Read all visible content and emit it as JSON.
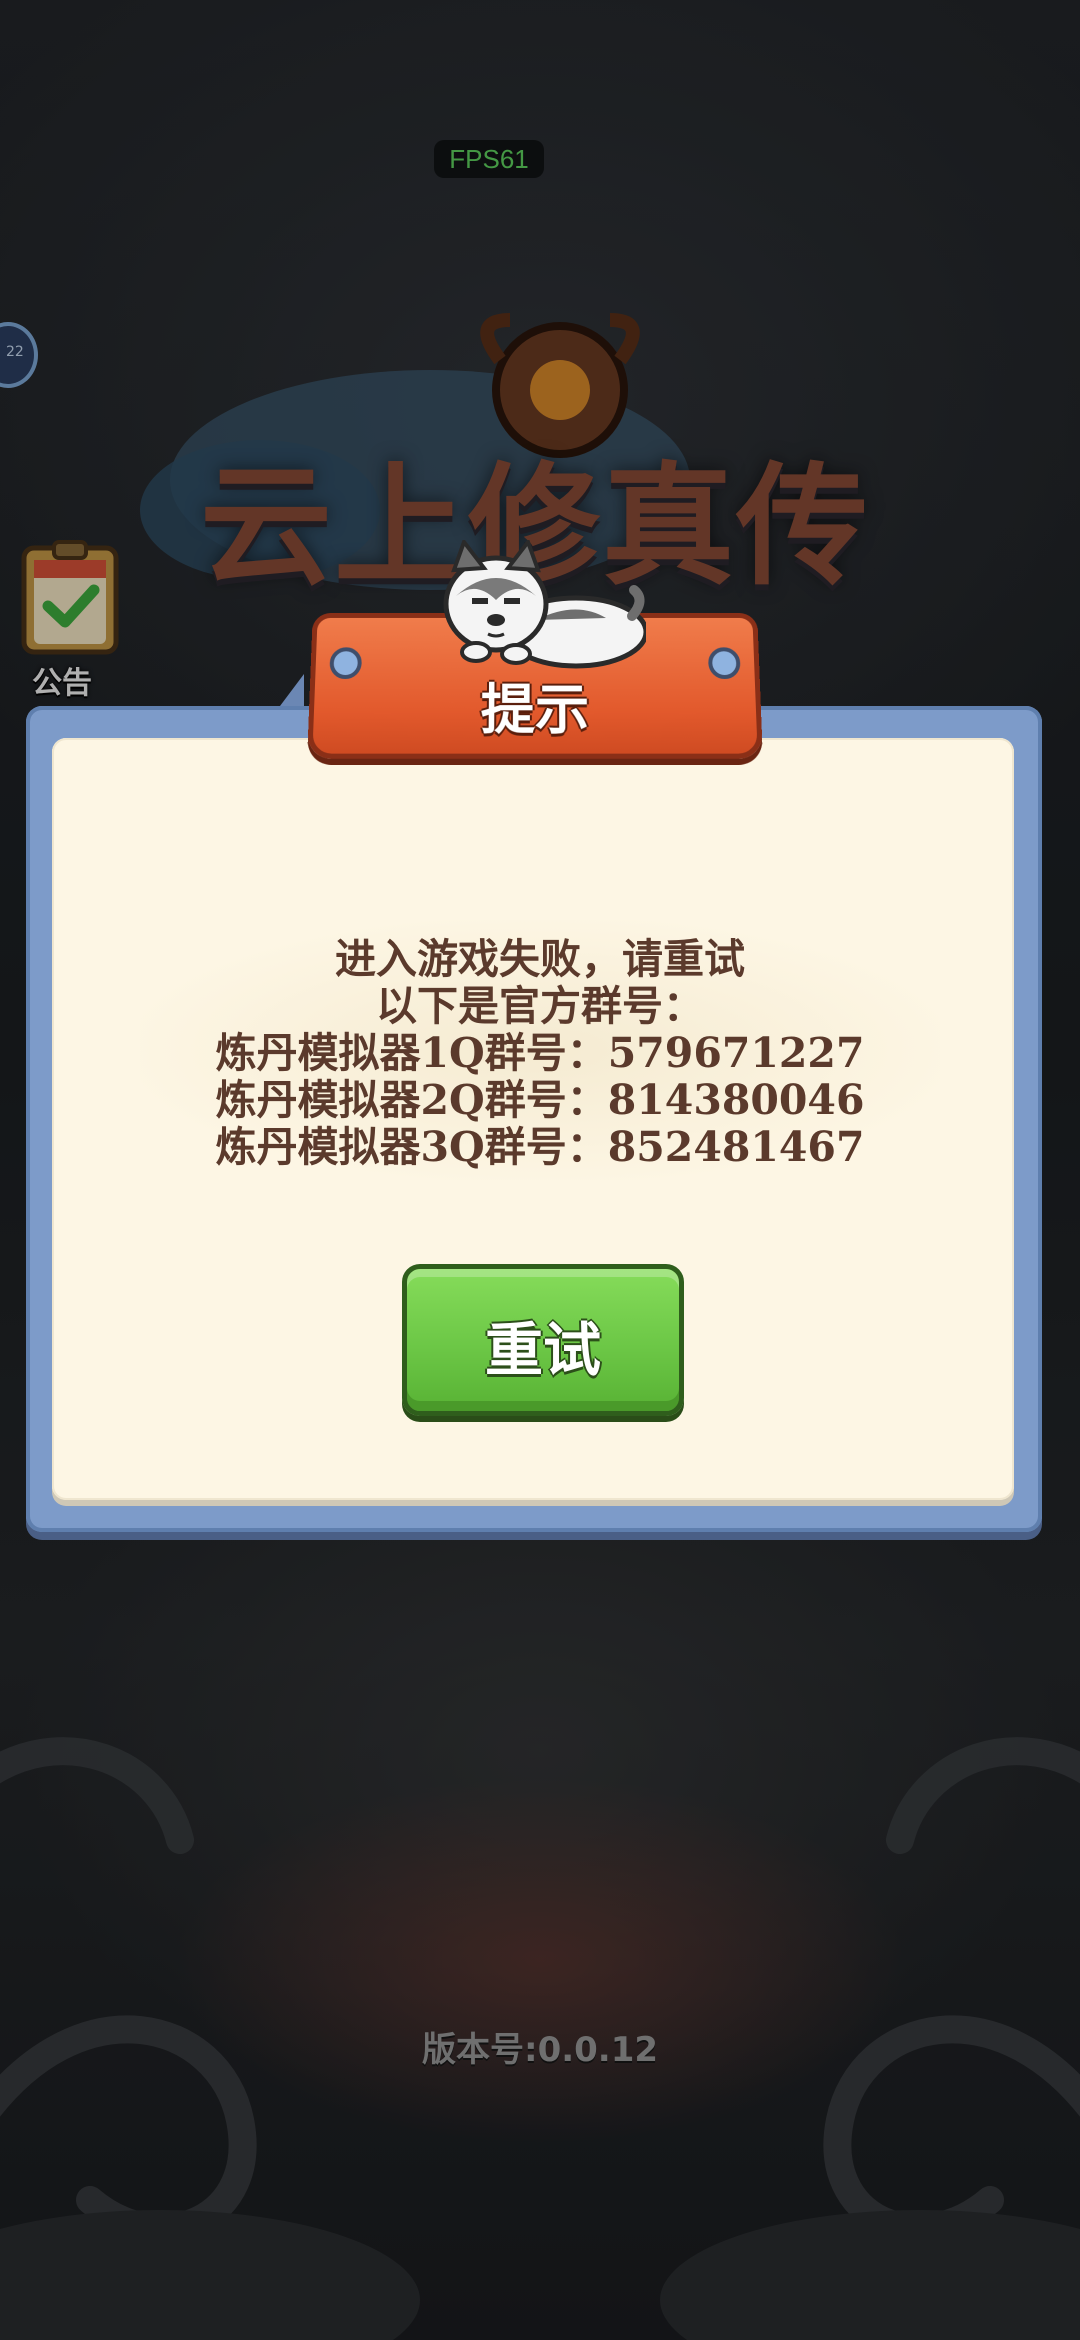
{
  "hud": {
    "fps": "FPS61"
  },
  "avatar": {
    "level_fragment": "22"
  },
  "notice": {
    "label": "公告"
  },
  "logo": {
    "title": "云上修真传"
  },
  "dialog": {
    "title": "提示",
    "message_lines": [
      "进入游戏失败，请重试",
      "以下是官方群号：",
      "炼丹模拟器1Q群号：579671227",
      "炼丹模拟器2Q群号：814380046",
      "炼丹模拟器3Q群号：852481467"
    ],
    "retry_label": "重试"
  },
  "footer": {
    "version": "版本号:0.0.12"
  },
  "colors": {
    "banner": "#e2592c",
    "frame": "#7d9bc9",
    "panel": "#fdf6e4",
    "text": "#5b3a2c",
    "retry": "#6cc746",
    "fps": "#5fd35f"
  }
}
